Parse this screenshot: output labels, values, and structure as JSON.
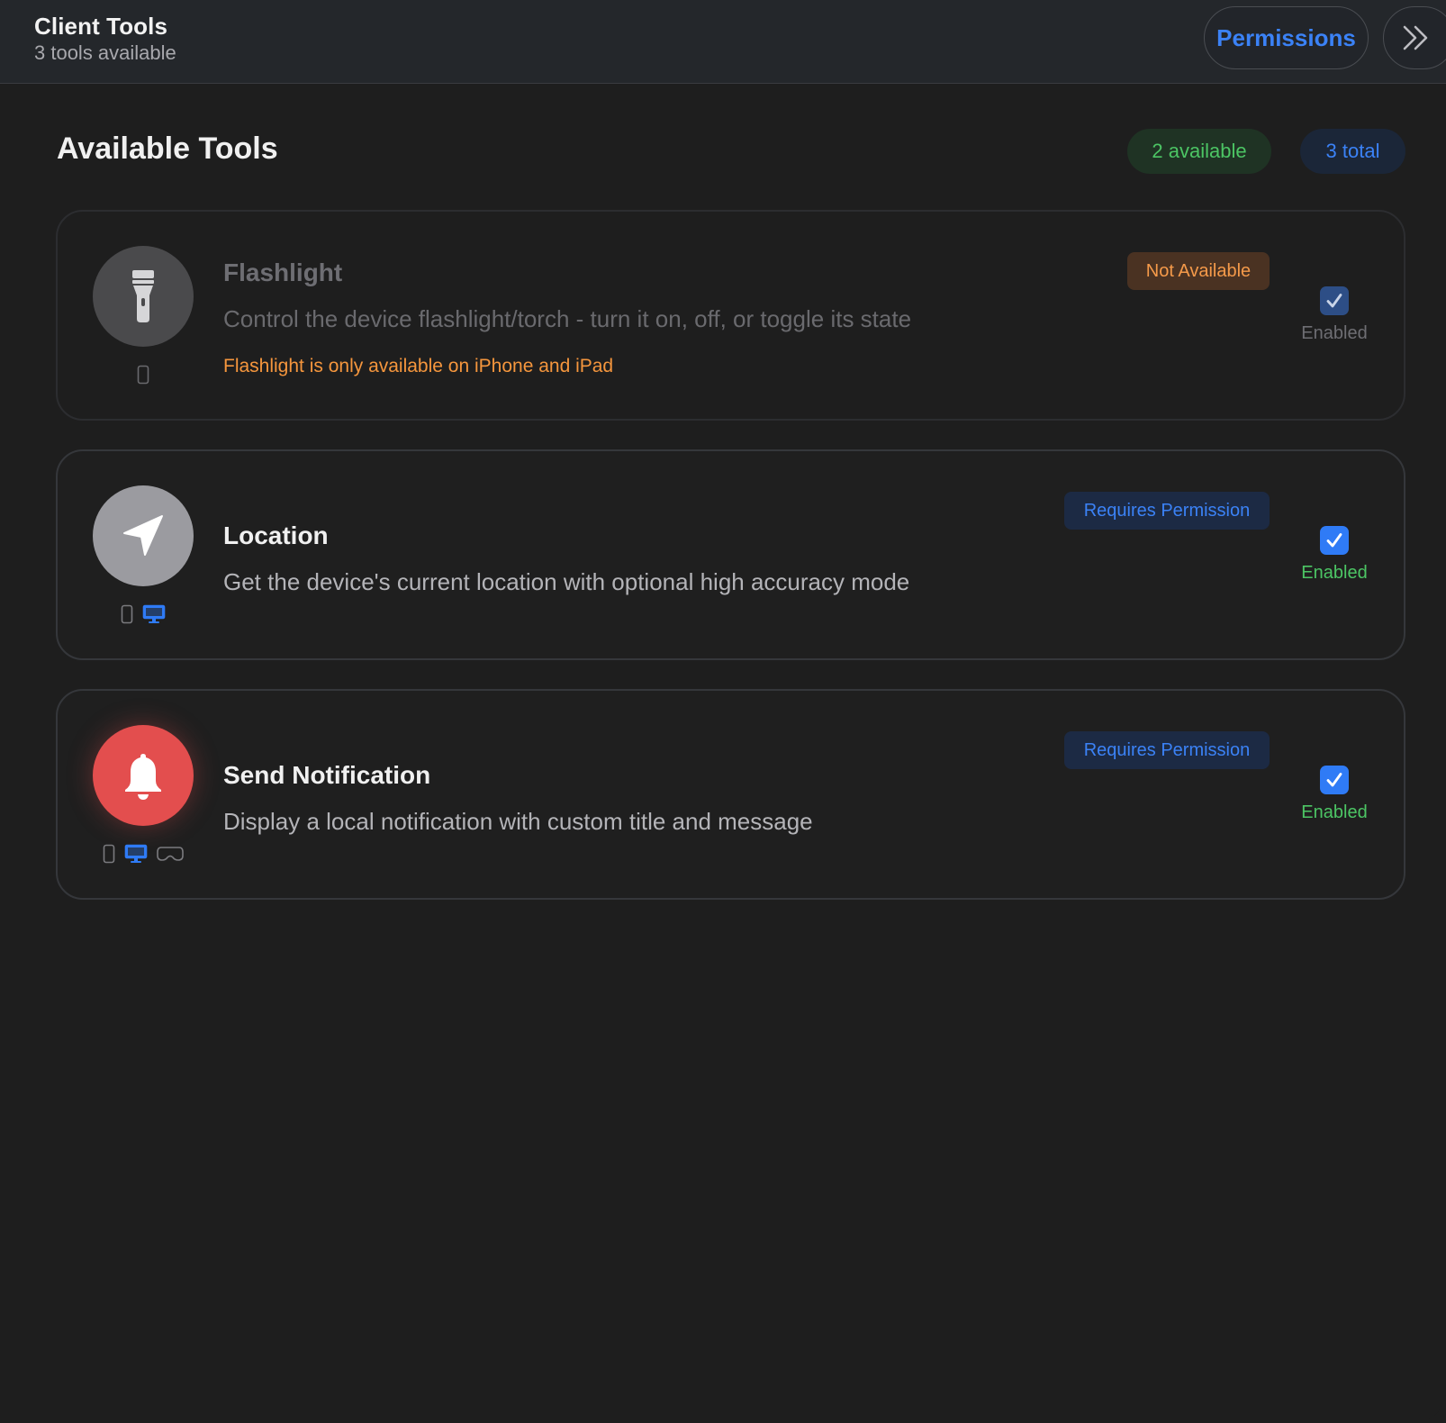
{
  "header": {
    "title": "Client Tools",
    "subtitle": "3 tools available",
    "permissions_label": "Permissions"
  },
  "section": {
    "title": "Available Tools",
    "available_count": "2 available",
    "total_count": "3 total"
  },
  "tools": [
    {
      "name": "Flashlight",
      "description": "Control the device flashlight/torch - turn it on, off, or toggle its state",
      "note": "Flashlight is only available on iPhone and iPad",
      "badge": "Not Available",
      "enabled_label": "Enabled",
      "enabled": true,
      "icon": "flashlight-icon",
      "platforms": [
        "phone-icon"
      ]
    },
    {
      "name": "Location",
      "description": "Get the device's current location with optional high accuracy mode",
      "badge": "Requires Permission",
      "enabled_label": "Enabled",
      "enabled": true,
      "icon": "location-arrow-icon",
      "platforms": [
        "phone-icon",
        "desktop-icon"
      ]
    },
    {
      "name": "Send Notification",
      "description": "Display a local notification with custom title and message",
      "badge": "Requires Permission",
      "enabled_label": "Enabled",
      "enabled": true,
      "icon": "bell-icon",
      "platforms": [
        "phone-icon",
        "desktop-icon",
        "vision-headset-icon"
      ]
    }
  ],
  "colors": {
    "accent_blue": "#3b82f6",
    "success_green": "#4cc564",
    "warning_orange": "#f5963d",
    "notification_red": "#e34e4e",
    "background": "#1e1e1e",
    "header_bg": "#24272b"
  }
}
